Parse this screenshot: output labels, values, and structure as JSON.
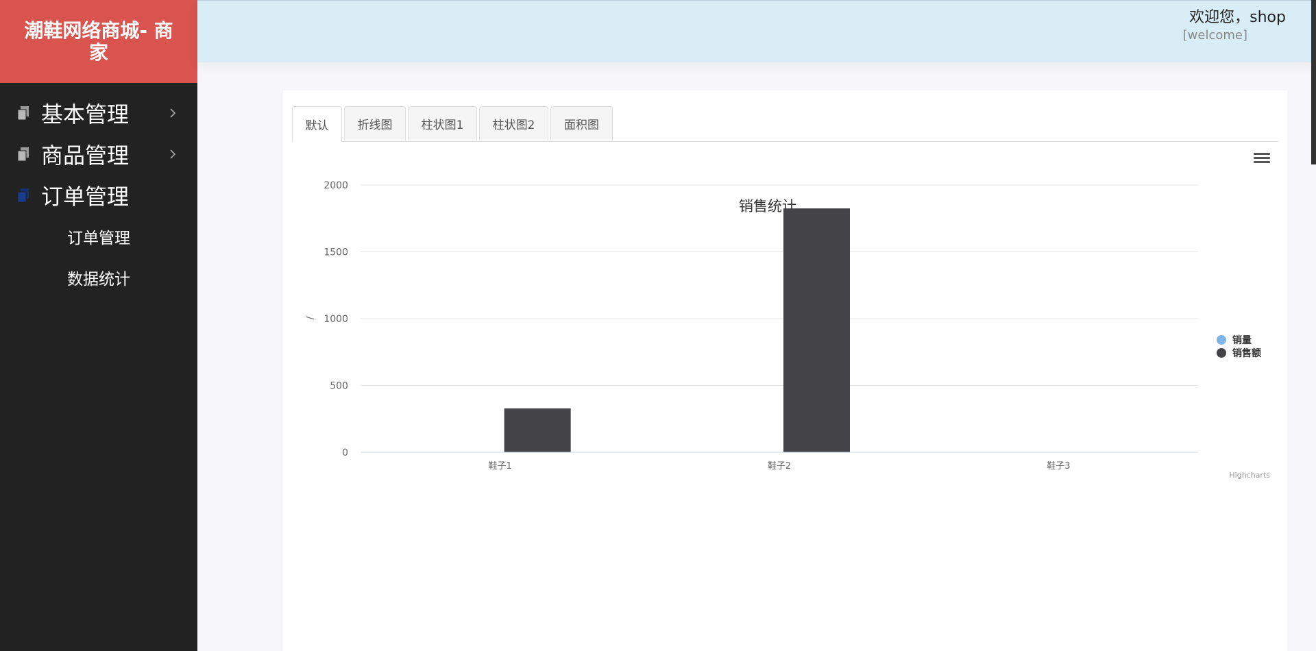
{
  "brand": {
    "title": "潮鞋网络商城- 商家"
  },
  "sidebar": {
    "items": [
      {
        "label": "基本管理",
        "icon": "copy-icon",
        "expanded": false
      },
      {
        "label": "商品管理",
        "icon": "copy-icon",
        "expanded": false
      },
      {
        "label": "订单管理",
        "icon": "copy-icon",
        "expanded": true
      }
    ],
    "subitems": [
      {
        "label": "订单管理"
      },
      {
        "label": "数据统计"
      }
    ]
  },
  "header": {
    "welcome": "欢迎您，shop",
    "tag": "[welcome]"
  },
  "tabs": [
    {
      "label": "默认",
      "active": true
    },
    {
      "label": "折线图",
      "active": false
    },
    {
      "label": "柱状图1",
      "active": false
    },
    {
      "label": "柱状图2",
      "active": false
    },
    {
      "label": "面积图",
      "active": false
    }
  ],
  "colors": {
    "brand": "#d9534f",
    "sidebar": "#222222",
    "header": "#d9edf7",
    "series_1": "#7cb5ec",
    "series_2": "#434348",
    "active_icon": "#1a3c8c"
  },
  "chart_data": {
    "type": "bar",
    "title": "销售统计",
    "ylabel": "/",
    "credits": "Highcharts",
    "categories": [
      "鞋子1",
      "鞋子2",
      "鞋子3"
    ],
    "ylim": [
      0,
      2000
    ],
    "yticks": [
      "0",
      "500",
      "1000",
      "1500",
      "2000"
    ],
    "legend_position": "right",
    "grid": true,
    "series": [
      {
        "name": "销量",
        "color": "#7cb5ec",
        "values": [
          0,
          0,
          0
        ]
      },
      {
        "name": "销售额",
        "color": "#434348",
        "values": [
          328,
          1825,
          0
        ]
      }
    ]
  }
}
